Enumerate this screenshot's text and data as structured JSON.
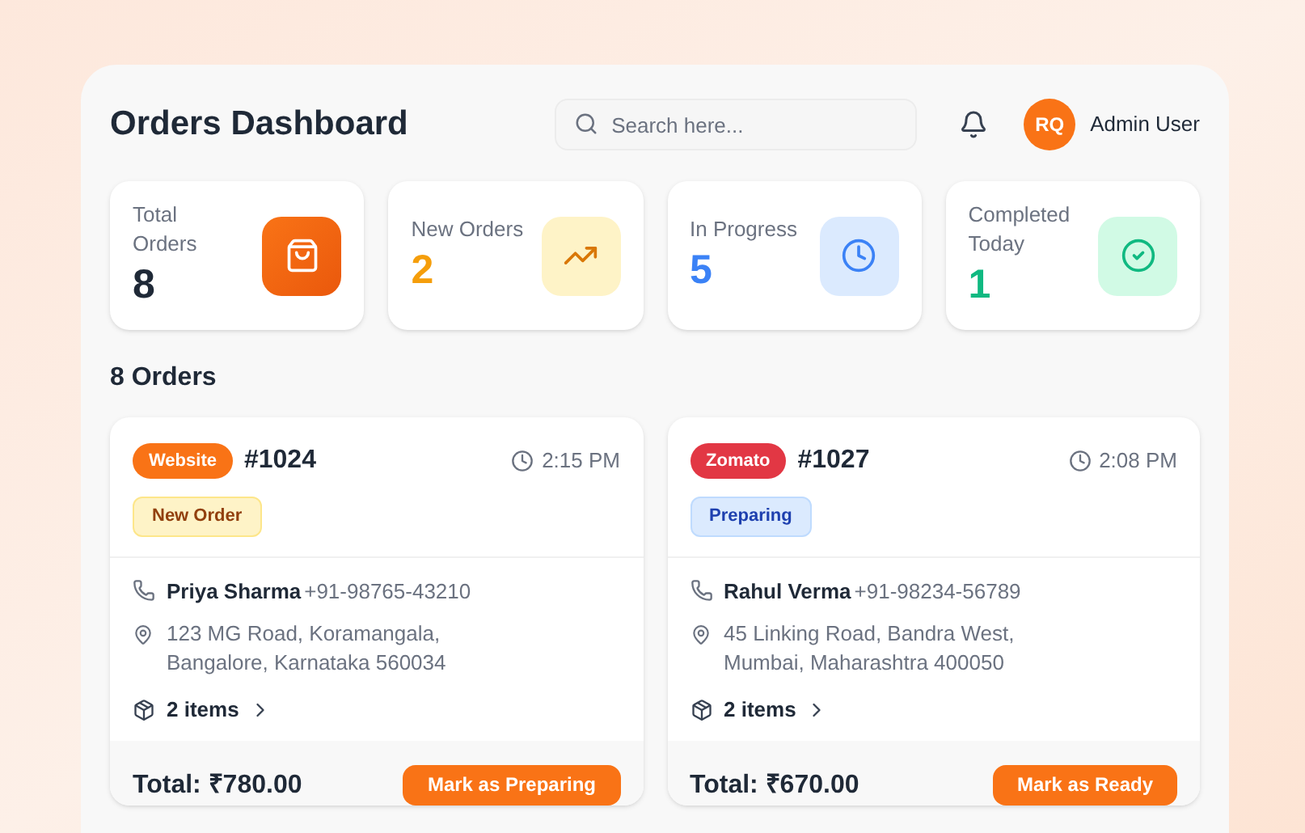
{
  "header": {
    "title": "Orders Dashboard",
    "search": {
      "placeholder": "Search here..."
    },
    "user": {
      "initials": "RQ",
      "name": "Admin User"
    }
  },
  "stats": [
    {
      "label": "Total Orders",
      "value": "8",
      "kind": "total"
    },
    {
      "label": "New Orders",
      "value": "2",
      "kind": "new"
    },
    {
      "label": "In Progress",
      "value": "5",
      "kind": "progress"
    },
    {
      "label": "Completed Today",
      "value": "1",
      "kind": "completed"
    }
  ],
  "orders_heading": "8 Orders",
  "orders": [
    {
      "source": {
        "label": "Website",
        "color": "#f97316"
      },
      "number": "#1024",
      "time": "2:15 PM",
      "status": {
        "label": "New Order",
        "kind": "new"
      },
      "customer": "Priya Sharma",
      "phone": "+91-98765-43210",
      "address": "123 MG Road, Koramangala, Bangalore, Karnataka 560034",
      "items": "2 items",
      "total": "Total: ₹780.00",
      "action": "Mark as Preparing"
    },
    {
      "source": {
        "label": "Zomato",
        "color": "#e23744"
      },
      "number": "#1027",
      "time": "2:08 PM",
      "status": {
        "label": "Preparing",
        "kind": "preparing"
      },
      "customer": "Rahul Verma",
      "phone": "+91-98234-56789",
      "address": "45 Linking Road, Bandra West, Mumbai, Maharashtra 400050",
      "items": "2 items",
      "total": "Total: ₹670.00",
      "action": "Mark as Ready"
    }
  ]
}
